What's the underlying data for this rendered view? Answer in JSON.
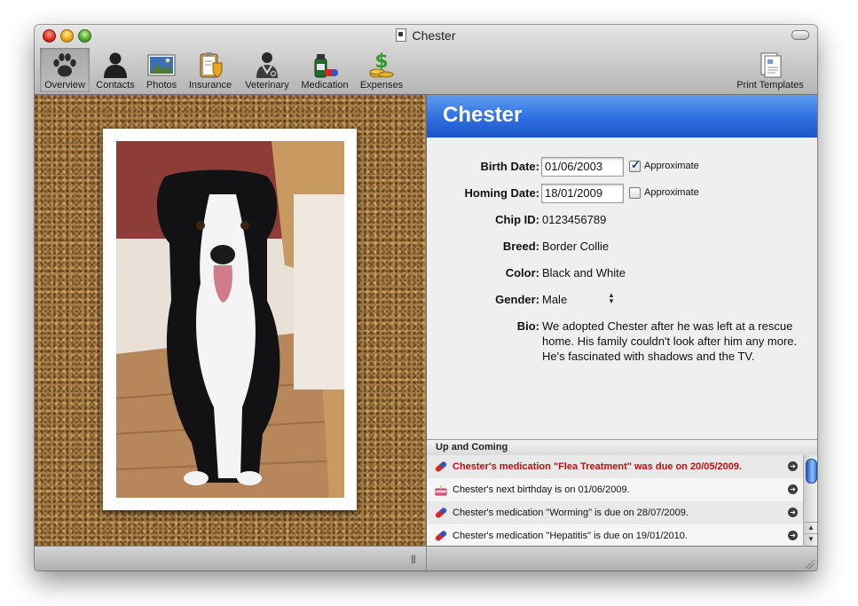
{
  "window": {
    "title": "Chester"
  },
  "toolbar": {
    "items": [
      {
        "label": "Overview",
        "icon": "paw-icon"
      },
      {
        "label": "Contacts",
        "icon": "person-icon"
      },
      {
        "label": "Photos",
        "icon": "photo-icon"
      },
      {
        "label": "Insurance",
        "icon": "insurance-icon"
      },
      {
        "label": "Veterinary",
        "icon": "vet-icon"
      },
      {
        "label": "Medication",
        "icon": "medication-icon"
      },
      {
        "label": "Expenses",
        "icon": "money-icon"
      }
    ],
    "print_templates": "Print Templates"
  },
  "pet": {
    "name": "Chester",
    "fields": {
      "birth_date_label": "Birth Date:",
      "birth_date": "01/06/2003",
      "birth_approx_label": "Approximate",
      "homing_date_label": "Homing Date:",
      "homing_date": "18/01/2009",
      "homing_approx_label": "Approximate",
      "chip_label": "Chip ID:",
      "chip": "0123456789",
      "breed_label": "Breed:",
      "breed": "Border Collie",
      "color_label": "Color:",
      "color": "Black and White",
      "gender_label": "Gender:",
      "gender": "Male",
      "bio_label": "Bio:",
      "bio": "We adopted Chester after he was left at a rescue home. His family couldn't look after him any more. He's fascinated with shadows and the TV."
    },
    "birth_approximate_checked": true,
    "homing_approximate_checked": false
  },
  "upcoming": {
    "title": "Up and Coming",
    "items": [
      {
        "text": "Chester's medication \"Flea Treatment\" was due on 20/05/2009.",
        "icon": "pill-icon",
        "overdue": true
      },
      {
        "text": "Chester's next birthday is on 01/06/2009.",
        "icon": "cake-icon",
        "overdue": false
      },
      {
        "text": "Chester's medication \"Worming\" is due on 28/07/2009.",
        "icon": "pill-icon",
        "overdue": false
      },
      {
        "text": "Chester's medication \"Hepatitis\" is due on 19/01/2010.",
        "icon": "pill-icon",
        "overdue": false
      }
    ]
  },
  "colors": {
    "header_blue": "#2f6ee0",
    "overdue_red": "#c01010",
    "cork": "#a67c44"
  }
}
